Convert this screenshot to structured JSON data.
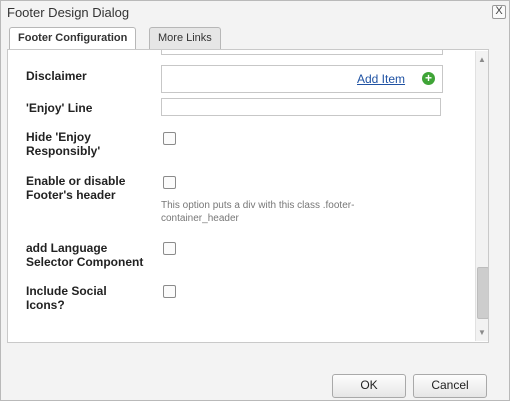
{
  "window": {
    "title": "Footer Design Dialog",
    "close_symbol": "X"
  },
  "tabs": [
    {
      "label": "Footer Configuration",
      "active": true
    },
    {
      "label": "More Links",
      "active": false
    }
  ],
  "form": {
    "disclaimer": {
      "label": "Disclaimer",
      "add_item": "Add Item"
    },
    "enjoy_line": {
      "label": "'Enjoy' Line",
      "value": ""
    },
    "hide_enjoy": {
      "label_line1": "Hide 'Enjoy",
      "label_line2": "Responsibly'",
      "checked": false
    },
    "footer_header": {
      "label_line1": "Enable or disable",
      "label_line2": "Footer's header",
      "checked": false,
      "hint_line1": "This option puts a div with this class .footer-",
      "hint_line2": "container_header"
    },
    "language_selector": {
      "label_line1": "add Language",
      "label_line2": "Selector Component",
      "checked": false
    },
    "social_icons": {
      "label_line1": "Include Social",
      "label_line2": "Icons?",
      "checked": false
    }
  },
  "buttons": {
    "ok": "OK",
    "cancel": "Cancel"
  },
  "icons": {
    "close": "close-icon",
    "add": "add-circle-icon"
  },
  "colors": {
    "link": "#1f52a3",
    "add_icon": "#3fa437"
  }
}
